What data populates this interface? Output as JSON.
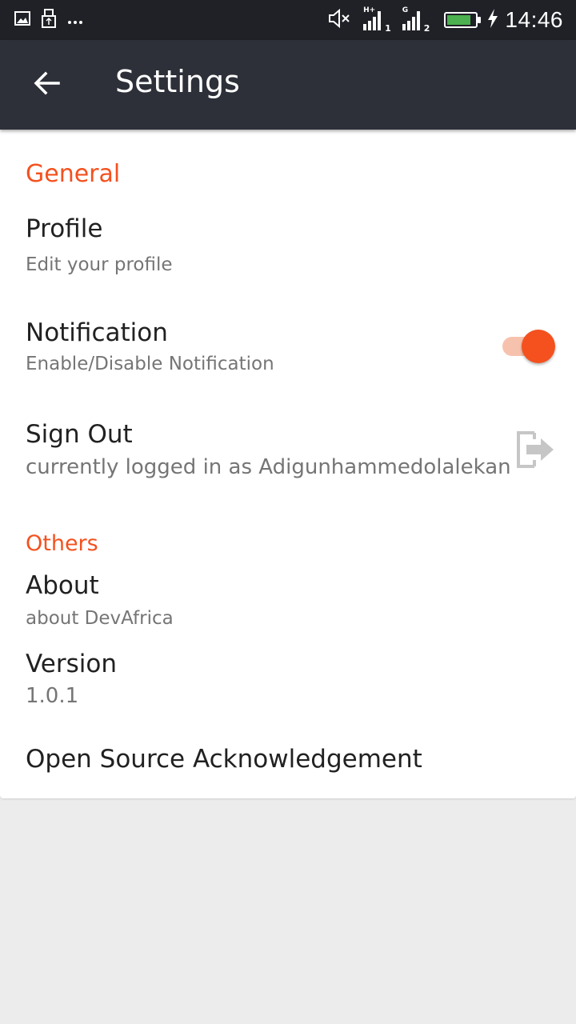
{
  "status_bar": {
    "time": "14:46",
    "left_icons": [
      "image-notification-icon",
      "usb-icon",
      "more-notifications-icon"
    ],
    "right_icons": [
      "mute-icon",
      "signal-sim1-icon",
      "signal-sim2-icon",
      "battery-icon",
      "charging-icon"
    ],
    "sim1_network": "H+",
    "sim1_index": "1",
    "sim2_network": "G",
    "sim2_index": "2",
    "battery_level": 0.85,
    "battery_color": "#4caf50"
  },
  "app_bar": {
    "title": "Settings",
    "back_icon": "arrow-back-icon",
    "background": "#2d3039"
  },
  "accent_color": "#f4511e",
  "sections": {
    "general": {
      "header": "General",
      "profile": {
        "title": "Profile",
        "subtitle": "Edit your profile"
      },
      "notification": {
        "title": "Notification",
        "subtitle": "Enable/Disable Notification",
        "enabled": true
      },
      "sign_out": {
        "title": "Sign Out",
        "subtitle": "currently logged in as Adigunhammedolalekan",
        "icon": "exit-to-app-icon"
      }
    },
    "others": {
      "header": "Others",
      "about": {
        "title": "About",
        "subtitle": "about DevAfrica"
      },
      "version": {
        "title": "Version",
        "subtitle": "1.0.1"
      },
      "licenses": {
        "title": "Open Source Acknowledgement"
      }
    }
  }
}
